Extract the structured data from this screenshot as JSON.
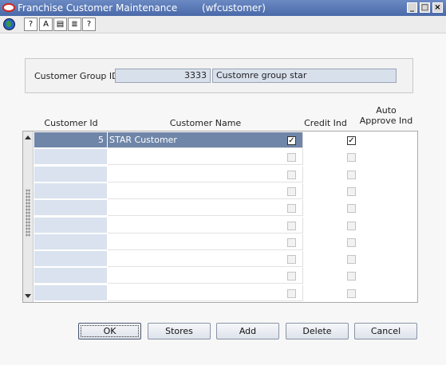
{
  "window": {
    "title": "Franchise Customer Maintenance",
    "module": "(wfcustomer)",
    "controls": [
      "minimize-icon",
      "maximize-icon",
      "close-icon"
    ]
  },
  "toolbar": {
    "icons": [
      "globe-icon",
      "help-icon",
      "text-icon",
      "clipboard-icon",
      "list-icon",
      "question-icon"
    ],
    "glyphs": [
      "?",
      "A",
      "▤",
      "≣",
      "?"
    ]
  },
  "group": {
    "label": "Customer Group ID",
    "id": "3333",
    "name": "Customre group star"
  },
  "grid": {
    "columns": {
      "customer_id": "Customer Id",
      "customer_name": "Customer Name",
      "credit_ind": "Credit Ind",
      "auto_approve_ind": "Auto\nApprove Ind"
    },
    "rows": [
      {
        "id": "5",
        "name": "STAR Customer",
        "credit": true,
        "auto_approve": true,
        "selected": true
      },
      {
        "id": "",
        "name": "",
        "credit": false,
        "auto_approve": false
      },
      {
        "id": "",
        "name": "",
        "credit": false,
        "auto_approve": false
      },
      {
        "id": "",
        "name": "",
        "credit": false,
        "auto_approve": false
      },
      {
        "id": "",
        "name": "",
        "credit": false,
        "auto_approve": false
      },
      {
        "id": "",
        "name": "",
        "credit": false,
        "auto_approve": false
      },
      {
        "id": "",
        "name": "",
        "credit": false,
        "auto_approve": false
      },
      {
        "id": "",
        "name": "",
        "credit": false,
        "auto_approve": false
      },
      {
        "id": "",
        "name": "",
        "credit": false,
        "auto_approve": false
      },
      {
        "id": "",
        "name": "",
        "credit": false,
        "auto_approve": false
      }
    ]
  },
  "buttons": {
    "ok": "OK",
    "stores": "Stores",
    "add": "Add",
    "delete": "Delete",
    "cancel": "Cancel"
  },
  "colors": {
    "title_bar": "#4a69a8",
    "selected_row": "#6f86a8",
    "id_cell": "#d9e2ee"
  }
}
